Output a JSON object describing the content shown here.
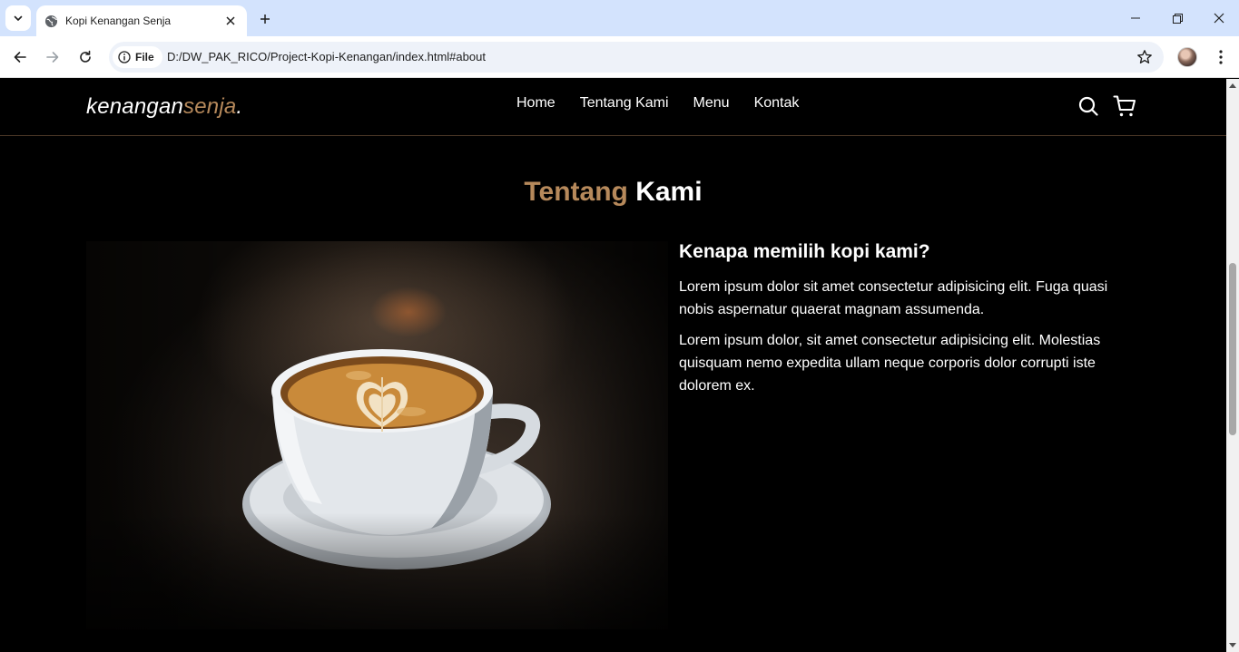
{
  "browser": {
    "tab_title": "Kopi Kenangan Senja",
    "site_info_label": "File",
    "url": "D:/DW_PAK_RICO/Project-Kopi-Kenangan/index.html#about"
  },
  "site": {
    "logo_main": "kenangan",
    "logo_accent": "senja",
    "logo_dot": ".",
    "nav": [
      {
        "label": "Home"
      },
      {
        "label": "Tentang Kami"
      },
      {
        "label": "Menu"
      },
      {
        "label": "Kontak"
      }
    ]
  },
  "about": {
    "title_accent": "Tentang",
    "title_rest": " Kami",
    "heading": "Kenapa memilih kopi kami?",
    "paragraphs": [
      "Lorem ipsum dolor sit amet consectetur adipisicing elit. Fuga quasi nobis aspernatur quaerat magnam assumenda.",
      "Lorem ipsum dolor, sit amet consectetur adipisicing elit. Molestias quisquam nemo expedita ullam neque corporis dolor corrupti iste dolorem ex."
    ],
    "image_icon": "coffee-cup-latte-art"
  },
  "colors": {
    "accent": "#b6895b",
    "background": "#000000",
    "tabstrip": "#d3e3fd"
  }
}
